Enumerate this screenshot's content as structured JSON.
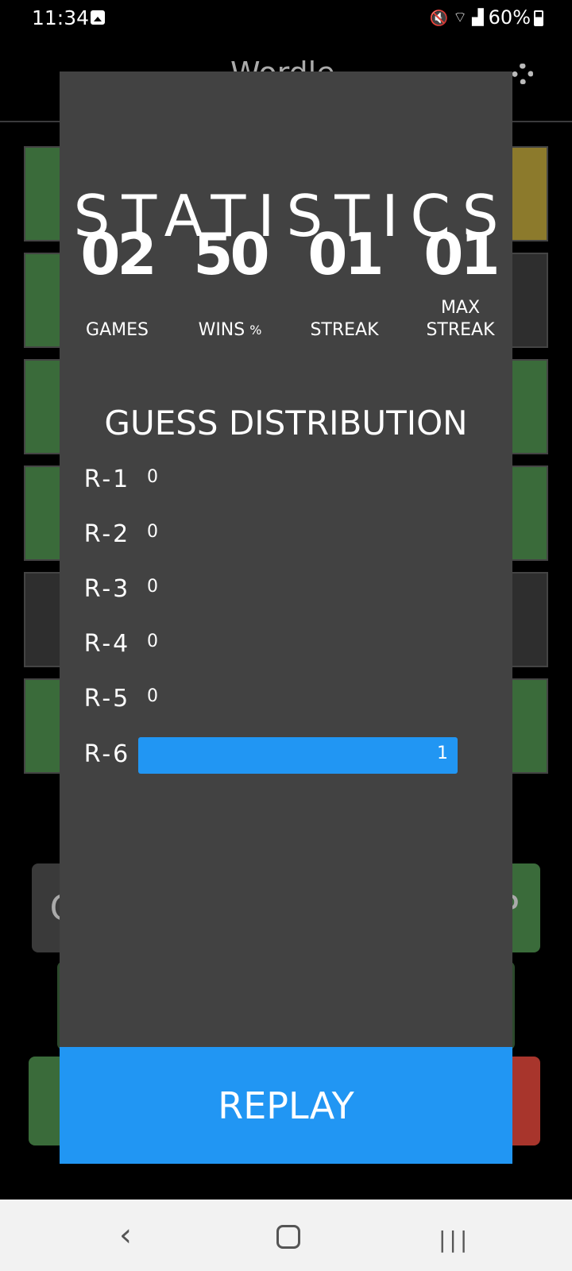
{
  "status_bar": {
    "time": "11:34",
    "icons": [
      "gallery-icon",
      "mute-icon",
      "wifi-icon",
      "signal-icon",
      "battery-icon"
    ],
    "battery": "60%"
  },
  "app": {
    "title": "Wordle",
    "keyboard_visible": [
      "Q",
      "P"
    ]
  },
  "stats_modal": {
    "title": "STATISTICS",
    "stats": [
      {
        "value": "02",
        "label": "GAMES"
      },
      {
        "value": "50",
        "label": "WINS",
        "suffix": "%"
      },
      {
        "value": "01",
        "label": "STREAK"
      },
      {
        "value": "01",
        "label": "MAX\nSTREAK"
      }
    ],
    "distribution_title": "GUESS DISTRIBUTION",
    "distribution": [
      {
        "label": "R-1",
        "count": "0"
      },
      {
        "label": "R-2",
        "count": "0"
      },
      {
        "label": "R-3",
        "count": "0"
      },
      {
        "label": "R-4",
        "count": "0"
      },
      {
        "label": "R-5",
        "count": "0"
      },
      {
        "label": "R-6",
        "count": "1"
      }
    ],
    "replay_label": "REPLAY"
  },
  "colors": {
    "accent": "#2196f3",
    "modal_bg": "#424242",
    "tile_green": "#3a6b3a",
    "tile_yellow": "#8c7a2c"
  }
}
